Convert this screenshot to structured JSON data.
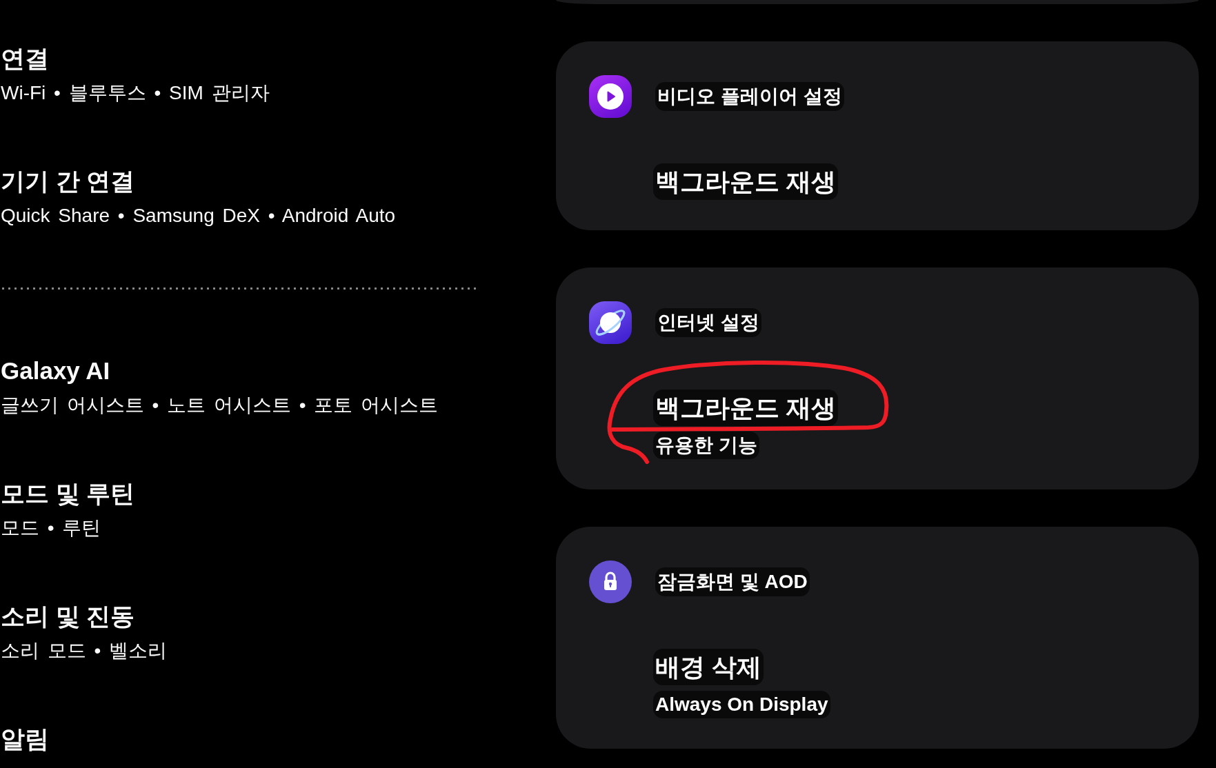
{
  "settings_list": {
    "groups": [
      {
        "items": [
          {
            "title": "연결",
            "subtitle": "Wi-Fi • 블루투스 • SIM 관리자"
          },
          {
            "title": "기기 간 연결",
            "subtitle": "Quick Share • Samsung DeX • Android Auto"
          }
        ]
      },
      {
        "items": [
          {
            "title": "Galaxy AI",
            "subtitle": "글쓰기 어시스트 • 노트 어시스트 • 포토 어시스트"
          },
          {
            "title": "모드 및 루틴",
            "subtitle": "모드 • 루틴"
          },
          {
            "title": "소리 및 진동",
            "subtitle": "소리 모드 • 벨소리"
          },
          {
            "title": "알림"
          }
        ]
      }
    ]
  },
  "search_results": [
    {
      "kind": "video",
      "app": "비디오 플레이어 설정",
      "match": {
        "title": "백그라운드 재생",
        "circled": false
      }
    },
    {
      "kind": "internet",
      "app": "인터넷 설정",
      "match": {
        "title": "백그라운드 재생",
        "subtitle": "유용한 기능",
        "circled": true
      }
    },
    {
      "kind": "lock",
      "app": "잠금화면 및 AOD",
      "match": {
        "title": "배경 삭제",
        "subtitle": "Always On Display",
        "circled": false
      }
    }
  ]
}
